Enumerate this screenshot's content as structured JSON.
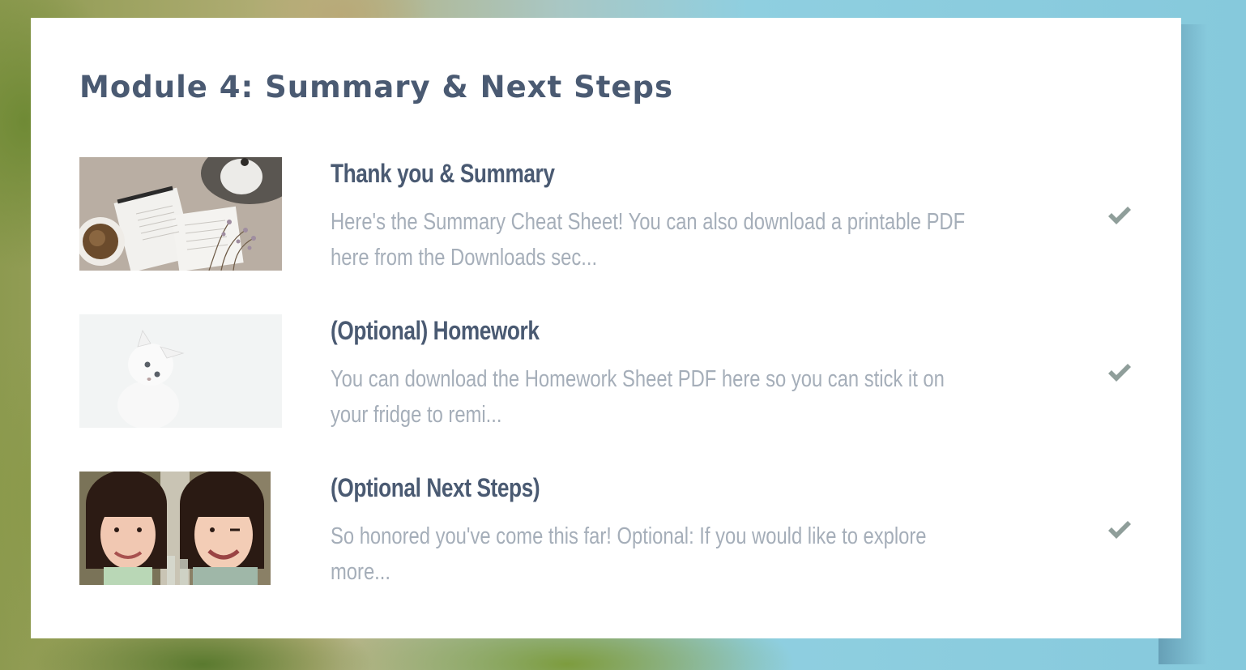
{
  "module": {
    "title": "Module 4: Summary & Next Steps"
  },
  "lessons": [
    {
      "title": "Thank you & Summary",
      "description": "Here's the Summary Cheat Sheet! You can also download a printable PDF here from the Downloads sec...",
      "completed": true,
      "thumbnail": "desk-with-cheat-sheet-and-coffee-image",
      "status_icon": "checkmark-icon"
    },
    {
      "title": "(Optional) Homework",
      "description": "You can download the Homework Sheet PDF here so you can stick it on your fridge to remi...",
      "completed": true,
      "thumbnail": "white-kitten-image",
      "status_icon": "checkmark-icon"
    },
    {
      "title": "(Optional Next Steps)",
      "description": "So honored you've come this far!  Optional: If you would like to explore more...",
      "completed": true,
      "thumbnail": "two-smiling-women-selfie-image",
      "status_icon": "checkmark-icon"
    }
  ],
  "colors": {
    "title": "#4a5a72",
    "description": "#a5aeb9",
    "check": "#8f9e9a",
    "card": "#ffffff"
  }
}
